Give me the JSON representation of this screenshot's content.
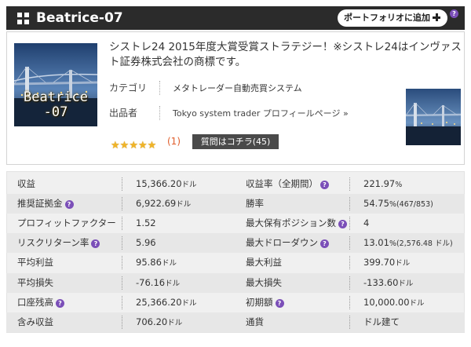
{
  "header": {
    "title": "Beatrice-07",
    "portfolio_button": "ポートフォリオに追加"
  },
  "strategy": {
    "logo_text_line1": "Beatrice",
    "logo_text_line2": "-07",
    "description": "シストレ24 2015年度大賞受賞ストラテジー！※シストレ24はインヴァスト証券株式会社の商標です。",
    "category_label": "カテゴリ",
    "category_value": "メタトレーダー自動売買システム",
    "publisher_label": "出品者",
    "publisher_value": "Tokyo system trader プロフィールページ »",
    "rating": 5,
    "review_count": "(1)",
    "question_button": "質問はコチラ(45)"
  },
  "stats": [
    {
      "l1": "収益",
      "v1": "15,366.20",
      "u1": "ドル",
      "l2": "収益率（全期間）",
      "h2": true,
      "v2": "221.97",
      "u2": "%"
    },
    {
      "l1": "推奨証拠金",
      "h1": true,
      "v1": "6,922.69",
      "u1": "ドル",
      "l2": "勝率",
      "v2": "54.75",
      "u2": "%",
      "x2": "(467/853)"
    },
    {
      "l1": "プロフィットファクター",
      "v1": "1.52",
      "l2": "最大保有ポジション数",
      "h2": true,
      "v2": "4"
    },
    {
      "l1": "リスクリターン率",
      "h1": true,
      "v1": "5.96",
      "l2": "最大ドローダウン",
      "h2": true,
      "v2": "13.01",
      "u2": "%",
      "x2": "(2,576.48 ドル)"
    },
    {
      "l1": "平均利益",
      "v1": "95.86",
      "u1": "ドル",
      "l2": "最大利益",
      "v2": "399.70",
      "u2": "ドル"
    },
    {
      "l1": "平均損失",
      "v1": "-76.16",
      "u1": "ドル",
      "l2": "最大損失",
      "v2": "-133.60",
      "u2": "ドル"
    },
    {
      "l1": "口座残高",
      "h1": true,
      "v1": "25,366.20",
      "u1": "ドル",
      "l2": "初期額",
      "h2": true,
      "v2": "10,000.00",
      "u2": "ドル"
    },
    {
      "l1": "含み収益",
      "v1": "706.20",
      "u1": "ドル",
      "l2": "通貨",
      "v2": "ドル建て"
    }
  ],
  "icons": {
    "help": "?",
    "star": "★"
  }
}
